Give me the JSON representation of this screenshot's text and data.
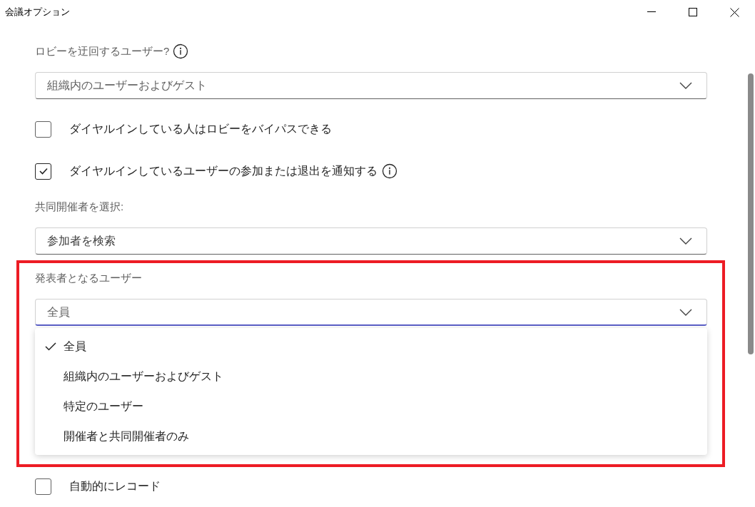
{
  "window": {
    "title": "会議オプション"
  },
  "sections": [
    {
      "kind": "dropdown",
      "label": "ロビーを迂回するユーザー?",
      "info": true,
      "value": "組織内のユーザーおよびゲスト",
      "expanded": false
    },
    {
      "kind": "checkbox",
      "label": "ダイヤルインしている人はロビーをバイパスできる",
      "checked": false
    },
    {
      "kind": "checkbox",
      "label": "ダイヤルインしているユーザーの参加または退出を通知する",
      "checked": true,
      "info": true
    },
    {
      "kind": "dropdown",
      "label": "共同開催者を選択:",
      "placeholder": "参加者を検索",
      "expanded": false
    },
    {
      "kind": "dropdown",
      "label": "発表者となるユーザー",
      "value": "全員",
      "expanded": true,
      "highlighted": true,
      "options": [
        {
          "label": "全員",
          "selected": true
        },
        {
          "label": "組織内のユーザーおよびゲスト",
          "selected": false
        },
        {
          "label": "特定のユーザー",
          "selected": false
        },
        {
          "label": "開催者と共同開催者のみ",
          "selected": false
        }
      ]
    },
    {
      "kind": "checkbox",
      "label": "自動的にレコード",
      "checked": false
    }
  ]
}
